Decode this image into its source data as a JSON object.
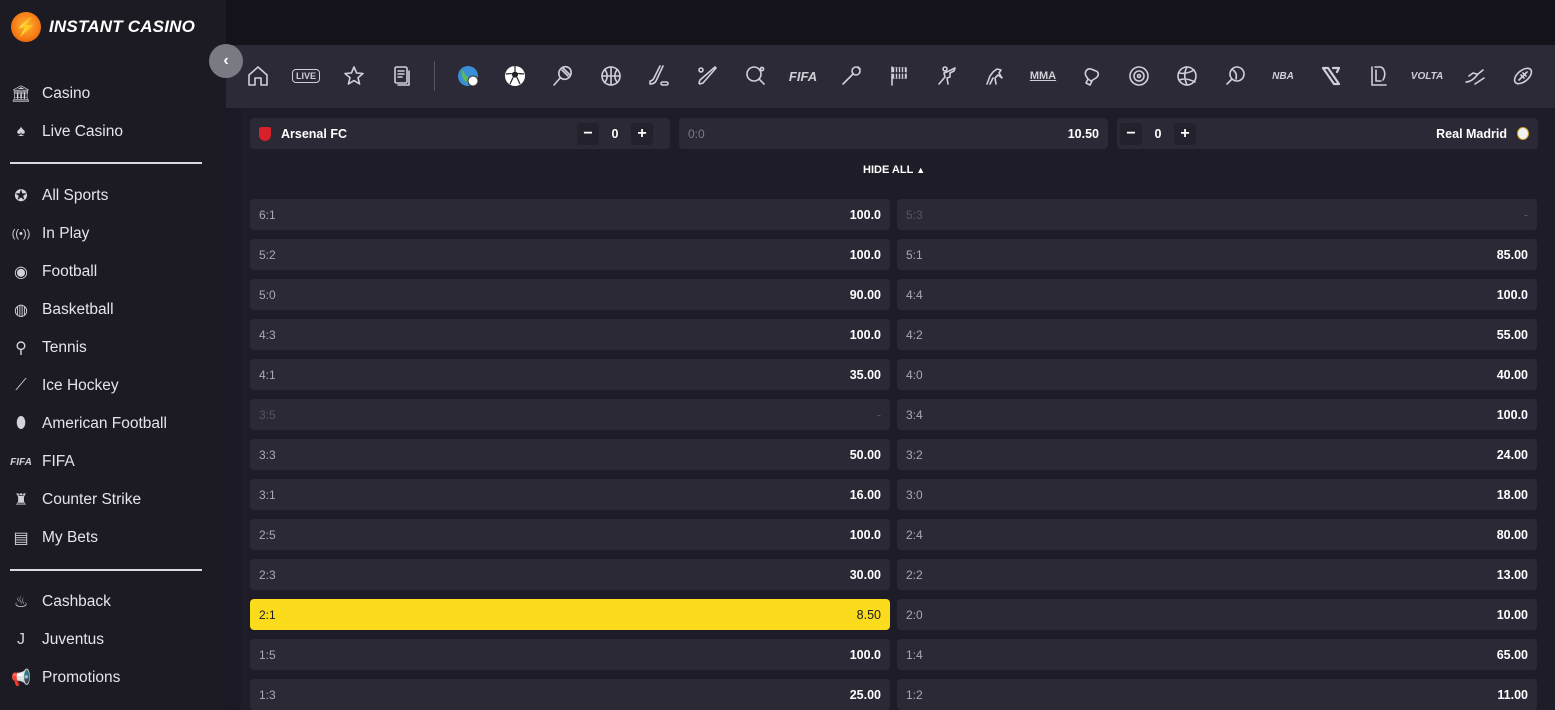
{
  "brand": {
    "name": "INSTANT CASINO"
  },
  "sidebar": {
    "groups": [
      [
        {
          "label": "Casino",
          "icon": "casino-icon"
        },
        {
          "label": "Live Casino",
          "icon": "spade-icon"
        }
      ],
      [
        {
          "label": "All Sports",
          "icon": "all-sports-icon"
        },
        {
          "label": "In Play",
          "icon": "broadcast-icon"
        },
        {
          "label": "Football",
          "icon": "football-icon"
        },
        {
          "label": "Basketball",
          "icon": "basketball-icon"
        },
        {
          "label": "Tennis",
          "icon": "tennis-icon"
        },
        {
          "label": "Ice Hockey",
          "icon": "hockey-icon"
        },
        {
          "label": "American Football",
          "icon": "american-football-icon"
        },
        {
          "label": "FIFA",
          "icon": "fifa-icon"
        },
        {
          "label": "Counter Strike",
          "icon": "counter-strike-icon"
        },
        {
          "label": "My Bets",
          "icon": "my-bets-icon"
        }
      ],
      [
        {
          "label": "Cashback",
          "icon": "flame-icon"
        },
        {
          "label": "Juventus",
          "icon": "juventus-icon"
        },
        {
          "label": "Promotions",
          "icon": "megaphone-icon"
        }
      ]
    ]
  },
  "sports_bar": {
    "icons": [
      "home-icon",
      "live-icon",
      "star-icon",
      "betslip-icon",
      "world-icon",
      "soccer-icon",
      "tennis-icon",
      "basketball-icon",
      "hockey-icon",
      "baseball-icon",
      "table-tennis-icon",
      "fifa-icon",
      "badminton-icon",
      "racing-flag-icon",
      "counter-strike-icon",
      "horse-racing-icon",
      "mma-icon",
      "boxing-icon",
      "darts-icon",
      "volleyball-icon",
      "handball-icon",
      "nba2k-icon",
      "esports-icon",
      "league-icon",
      "volta-icon",
      "skiing-icon",
      "rugby-icon"
    ],
    "live_label": "LIVE",
    "fifa_label": "FIFA",
    "mma_label": "MMA",
    "nba_label": "NBA",
    "volta_label": "VOLTA"
  },
  "match": {
    "home": {
      "name": "Arsenal FC",
      "goals": "0"
    },
    "away": {
      "name": "Real Madrid",
      "goals": "0"
    },
    "current": {
      "score": "0:0",
      "odds": "10.50"
    }
  },
  "hide_all_label": "HIDE ALL",
  "odds": {
    "left": [
      {
        "score": "6:1",
        "price": "100.0"
      },
      {
        "score": "5:2",
        "price": "100.0"
      },
      {
        "score": "5:0",
        "price": "90.00"
      },
      {
        "score": "4:3",
        "price": "100.0"
      },
      {
        "score": "4:1",
        "price": "35.00"
      },
      {
        "score": "3:5",
        "price": "-",
        "disabled": true
      },
      {
        "score": "3:3",
        "price": "50.00"
      },
      {
        "score": "3:1",
        "price": "16.00"
      },
      {
        "score": "2:5",
        "price": "100.0"
      },
      {
        "score": "2:3",
        "price": "30.00"
      },
      {
        "score": "2:1",
        "price": "8.50",
        "selected": true
      },
      {
        "score": "1:5",
        "price": "100.0"
      },
      {
        "score": "1:3",
        "price": "25.00"
      }
    ],
    "right": [
      {
        "score": "5:3",
        "price": "-",
        "disabled": true
      },
      {
        "score": "5:1",
        "price": "85.00"
      },
      {
        "score": "4:4",
        "price": "100.0"
      },
      {
        "score": "4:2",
        "price": "55.00"
      },
      {
        "score": "4:0",
        "price": "40.00"
      },
      {
        "score": "3:4",
        "price": "100.0"
      },
      {
        "score": "3:2",
        "price": "24.00"
      },
      {
        "score": "3:0",
        "price": "18.00"
      },
      {
        "score": "2:4",
        "price": "80.00"
      },
      {
        "score": "2:2",
        "price": "13.00"
      },
      {
        "score": "2:0",
        "price": "10.00"
      },
      {
        "score": "1:4",
        "price": "65.00"
      },
      {
        "score": "1:2",
        "price": "11.00"
      }
    ]
  },
  "colors": {
    "selected": "#fbdc1d",
    "cell": "#2a2935",
    "background": "#1e1d27"
  }
}
